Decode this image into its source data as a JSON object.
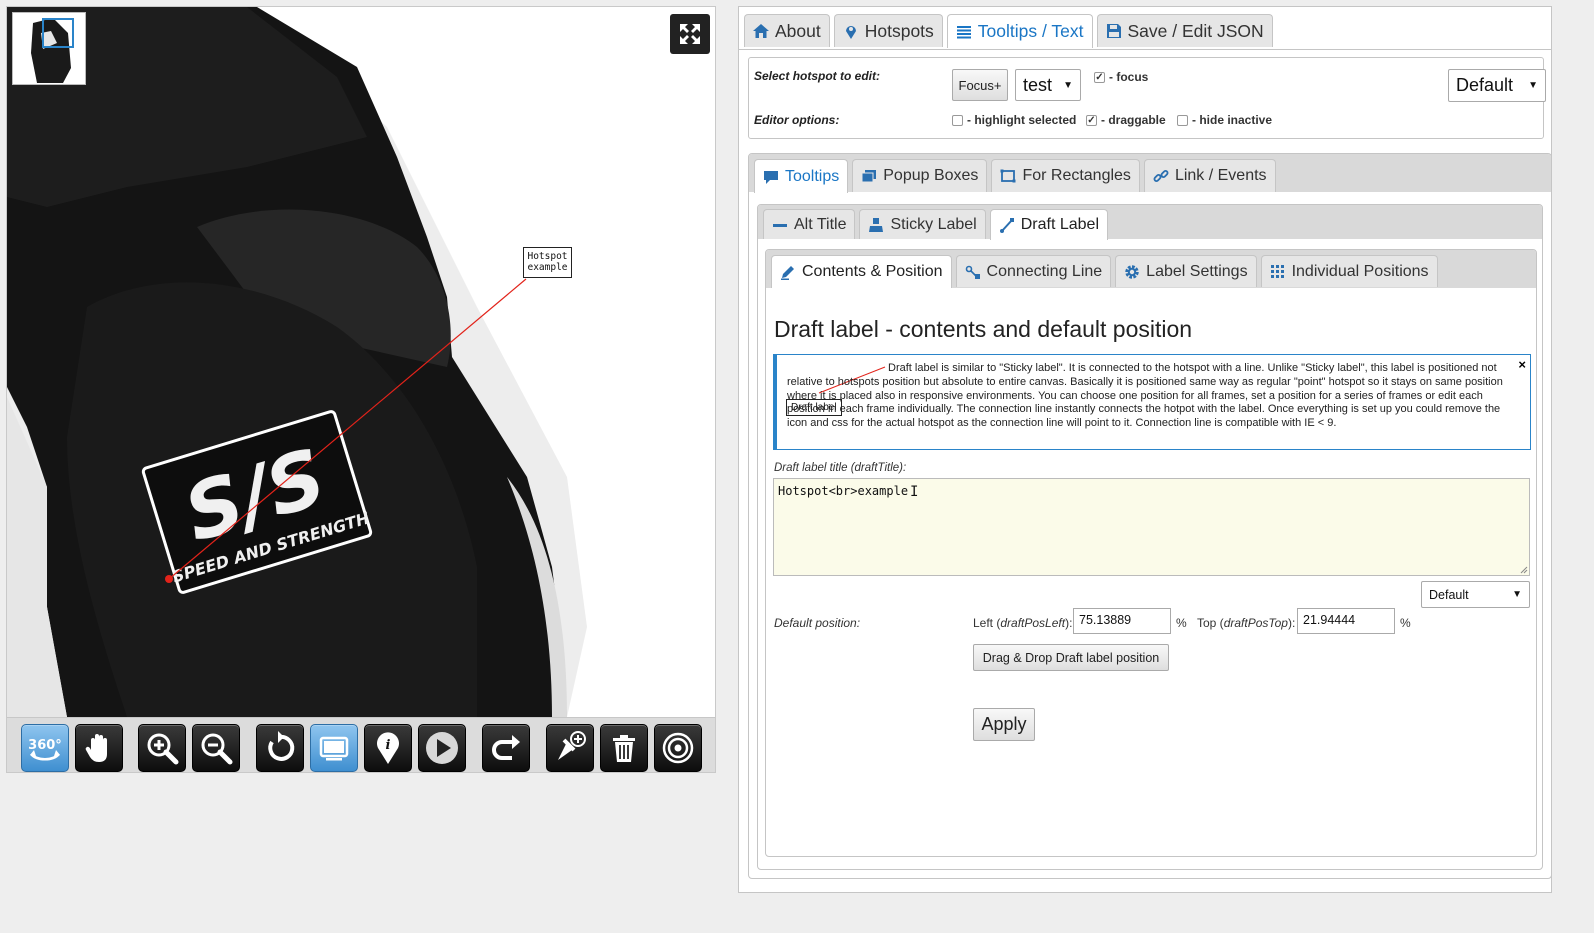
{
  "viewer": {
    "hotspot_label_line1": "Hotspot",
    "hotspot_label_line2": "example",
    "patch_logo_text": "S/S",
    "patch_tagline": "SPEED AND STRENGTH",
    "toolbar_icons": [
      "360-rotate-icon",
      "hand-pan-icon",
      "zoom-in-icon",
      "zoom-out-icon",
      "reset-icon",
      "window-icon",
      "info-pin-icon",
      "play-icon",
      "redo-icon",
      "add-hotspot-icon",
      "trash-icon",
      "target-icon"
    ],
    "accent_color": "#3f8fd0"
  },
  "main_tabs": [
    {
      "label": "About",
      "icon": "home-icon"
    },
    {
      "label": "Hotspots",
      "icon": "map-marker-icon"
    },
    {
      "label": "Tooltips / Text",
      "icon": "list-icon",
      "active": true
    },
    {
      "label": "Save / Edit JSON",
      "icon": "floppy-disk-icon"
    }
  ],
  "hotspot_select": {
    "select_label": "Select hotspot to edit:",
    "focus_button": "Focus+",
    "selected_hotspot": "test",
    "focus_checkbox": "- focus",
    "focus_checked": true,
    "mode_select": "Default",
    "editor_options_label": "Editor options:",
    "highlight_selected": "- highlight selected",
    "highlight_checked": false,
    "draggable": "- draggable",
    "draggable_checked": true,
    "hide_inactive": "- hide inactive",
    "hide_inactive_checked": false
  },
  "sub_tabs": [
    {
      "label": "Tooltips",
      "icon": "speech-bubble-icon",
      "active": true
    },
    {
      "label": "Popup Boxes",
      "icon": "windows-icon"
    },
    {
      "label": "For Rectangles",
      "icon": "rectangle-icon"
    },
    {
      "label": "Link / Events",
      "icon": "link-icon"
    }
  ],
  "tooltip_tabs": [
    {
      "label": "Alt Title",
      "icon": "minus-icon"
    },
    {
      "label": "Sticky Label",
      "icon": "user-icon"
    },
    {
      "label": "Draft Label",
      "icon": "line-icon",
      "active": true
    }
  ],
  "draft_tabs": [
    {
      "label": "Contents & Position",
      "icon": "pencil-icon",
      "active": true
    },
    {
      "label": "Connecting Line",
      "icon": "connect-icon"
    },
    {
      "label": "Label Settings",
      "icon": "gear-icon"
    },
    {
      "label": "Individual Positions",
      "icon": "grid-icon"
    }
  ],
  "draft": {
    "title": "Draft label - contents and default position",
    "info_mini_label": "Draft label",
    "info_text": "Draft label is similar to \"Sticky label\". It is connected to the hotspot with a line. Unlike \"Sticky label\", this label is positioned not relative to hotspots position but absolute to entire canvas. Basically it is positioned same way as regular \"point\" hotspot so it stays on same position where it is placed also in responsive environments. You can choose one position for all frames, set a position for a series of frames or edit each position in each frame individually. The connection line instantly connects the hotpot with the label. Once everything is set up you could remove the icon and css for the actual hotspot as the connection line will point to it. Connection line is compatible with IE < 9.",
    "info_close": "×",
    "textarea_label": "Draft label title (draftTitle):",
    "textarea_value": "Hotspot<br>example",
    "position_select": "Default",
    "default_position_label": "Default position:",
    "left_label": "Left (",
    "left_param": "draftPosLeft",
    "left_label_end": "):",
    "left_value": "75.13889",
    "percent": "%",
    "top_label": "Top (",
    "top_param": "draftPosTop",
    "top_label_end": "):",
    "top_value": "21.94444",
    "drag_button": "Drag & Drop Draft label position",
    "apply_button": "Apply"
  }
}
